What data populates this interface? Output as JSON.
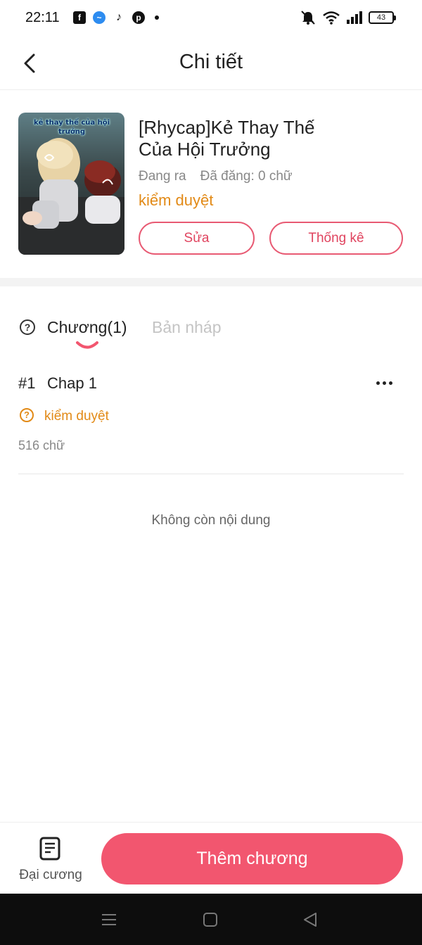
{
  "status_bar": {
    "time": "22:11",
    "battery": "43",
    "apps": [
      "facebook-icon",
      "messenger-icon",
      "tiktok-icon",
      "pinterest-icon"
    ]
  },
  "header": {
    "title": "Chi tiết"
  },
  "book": {
    "title": "[Rhycap]Kẻ Thay Thế Của Hội Trưởng",
    "cover_caption": "kẻ thay thế của hội trưởng",
    "publish_state": "Đang ra",
    "word_count": "Đã đăng: 0 chữ",
    "review_status": "kiểm duyệt",
    "edit_label": "Sửa",
    "stats_label": "Thống kê"
  },
  "tabs": {
    "chapters_label": "Chương(1)",
    "drafts_label": "Bản nháp"
  },
  "chapters": [
    {
      "number": "#1",
      "title": "Chap 1",
      "status": "kiểm duyệt",
      "words": "516 chữ"
    }
  ],
  "list_end_message": "Không còn nội dung",
  "bottom_bar": {
    "outline_label": "Đại cương",
    "add_chapter_label": "Thêm chương"
  },
  "colors": {
    "accent": "#f2566f",
    "warning": "#e28a17",
    "muted": "#888888"
  }
}
